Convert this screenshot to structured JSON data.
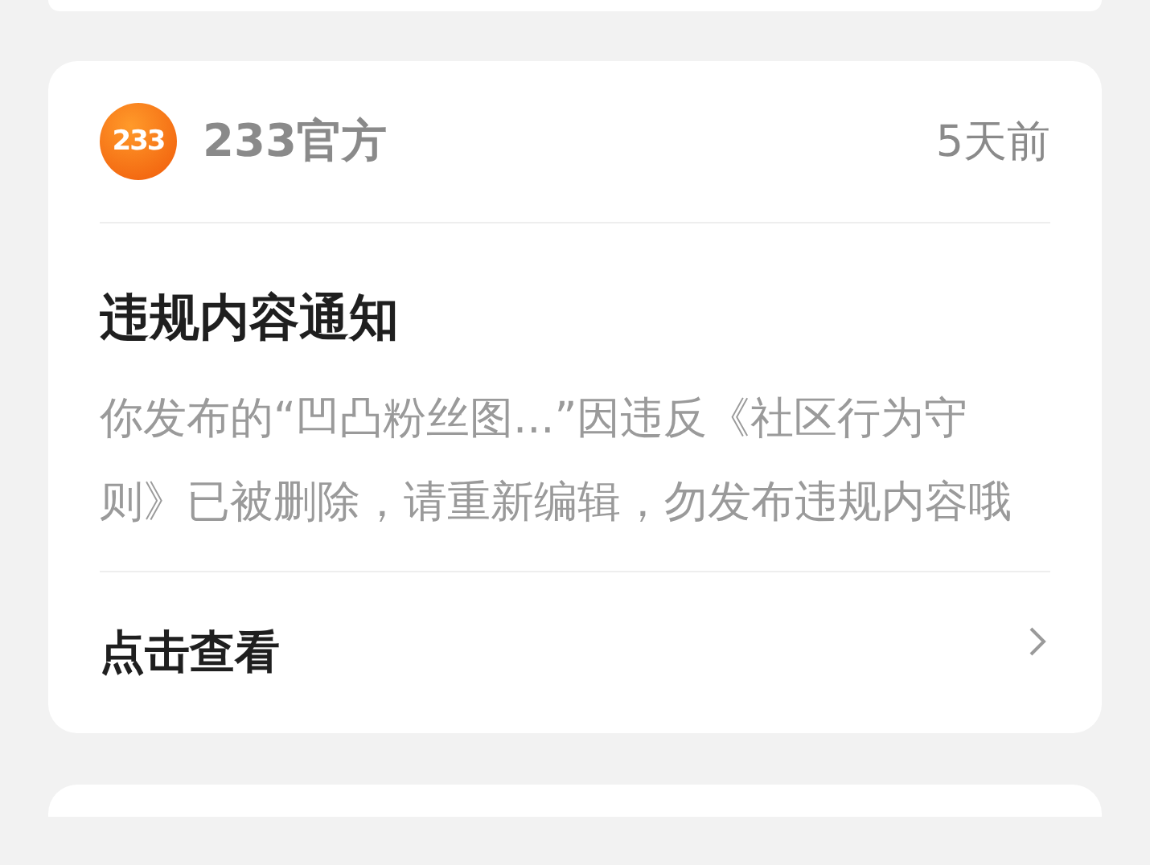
{
  "notice": {
    "avatar_text": "233",
    "sender": "233官方",
    "time": "5天前",
    "title": "违规内容通知",
    "body": "你发布的“凹凸粉丝图...”因违反《社区行为守则》已被删除，请重新编辑，勿发布违规内容哦",
    "action": "点击查看"
  }
}
